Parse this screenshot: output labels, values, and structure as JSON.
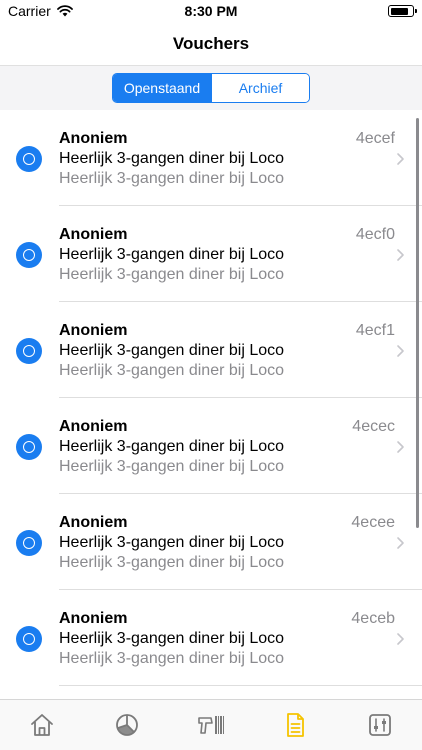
{
  "status_bar": {
    "carrier": "Carrier",
    "time": "8:30 PM",
    "battery_level": 0.85
  },
  "nav": {
    "title": "Vouchers"
  },
  "segments": [
    {
      "label": "Openstaand",
      "active": true
    },
    {
      "label": "Archief",
      "active": false
    }
  ],
  "vouchers": [
    {
      "name": "Anoniem",
      "code": "4ecef",
      "line1": "Heerlijk 3-gangen diner bij Loco",
      "line2": "Heerlijk 3-gangen diner bij Loco"
    },
    {
      "name": "Anoniem",
      "code": "4ecf0",
      "line1": "Heerlijk 3-gangen diner bij Loco",
      "line2": "Heerlijk 3-gangen diner bij Loco"
    },
    {
      "name": "Anoniem",
      "code": "4ecf1",
      "line1": "Heerlijk 3-gangen diner bij Loco",
      "line2": "Heerlijk 3-gangen diner bij Loco"
    },
    {
      "name": "Anoniem",
      "code": "4ecec",
      "line1": "Heerlijk 3-gangen diner bij Loco",
      "line2": "Heerlijk 3-gangen diner bij Loco"
    },
    {
      "name": "Anoniem",
      "code": "4ecee",
      "line1": "Heerlijk 3-gangen diner bij Loco",
      "line2": "Heerlijk 3-gangen diner bij Loco"
    },
    {
      "name": "Anoniem",
      "code": "4eceb",
      "line1": "Heerlijk 3-gangen diner bij Loco",
      "line2": "Heerlijk 3-gangen diner bij Loco"
    }
  ],
  "tabs": [
    {
      "icon": "home-icon",
      "active": false
    },
    {
      "icon": "pie-chart-icon",
      "active": false
    },
    {
      "icon": "barcode-scanner-icon",
      "active": false
    },
    {
      "icon": "document-icon",
      "active": true
    },
    {
      "icon": "sliders-icon",
      "active": false
    }
  ],
  "colors": {
    "accent": "#1a7df0",
    "tab_active": "#f5c400",
    "tab_inactive": "#7a7a7a",
    "secondary_text": "#8a8a8e"
  }
}
